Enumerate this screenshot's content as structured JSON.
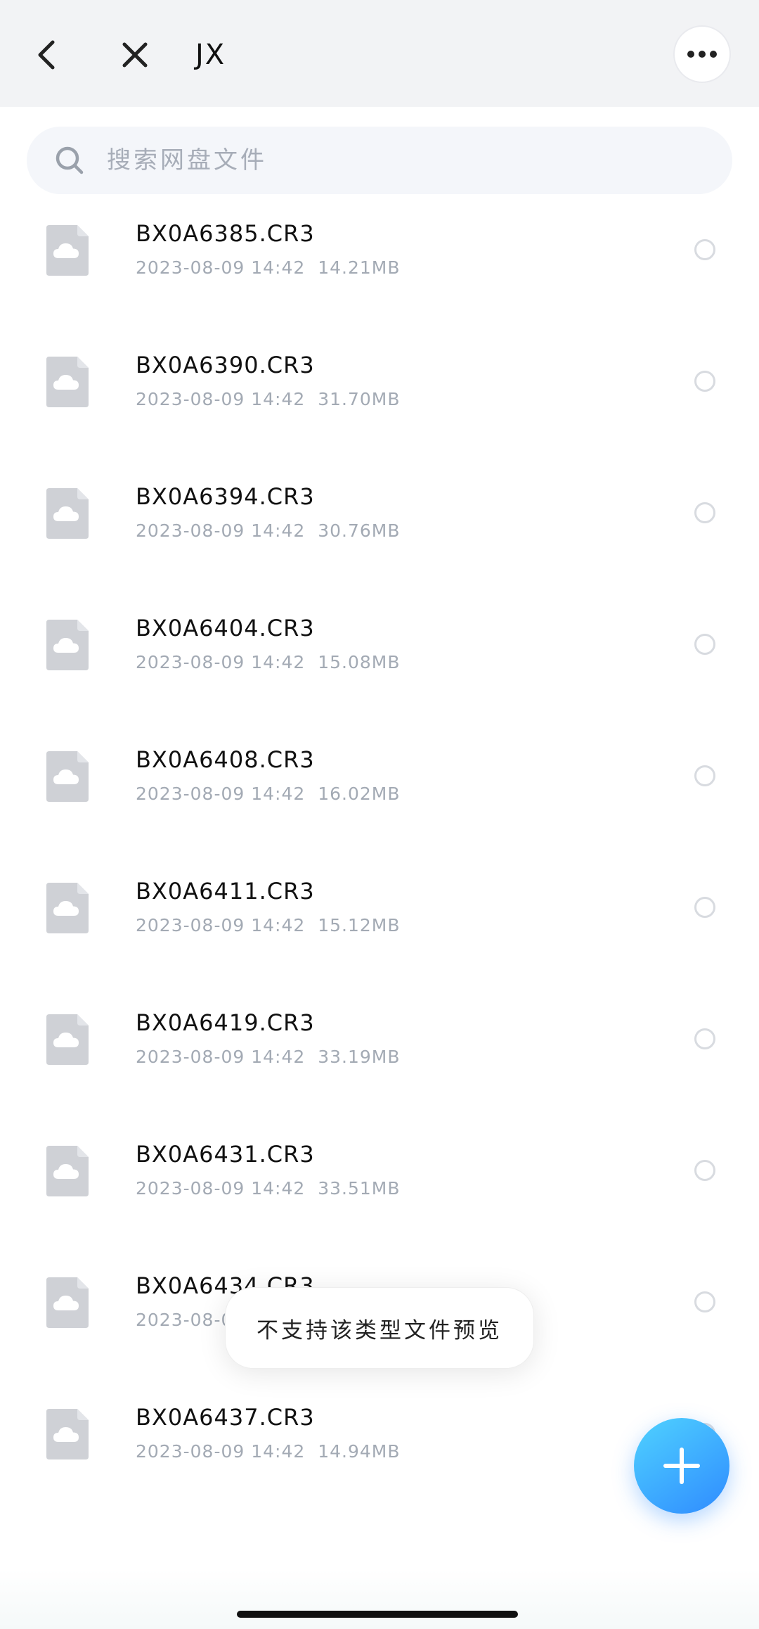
{
  "header": {
    "title": "JX",
    "back_icon": "chevron-left-icon",
    "close_icon": "close-icon",
    "more_icon": "more-horizontal-icon"
  },
  "search": {
    "placeholder": "搜索网盘文件",
    "icon": "search-icon"
  },
  "files": [
    {
      "name": "BX0A6385.CR3",
      "date": "2023-08-09 14:42",
      "size": "14.21MB"
    },
    {
      "name": "BX0A6390.CR3",
      "date": "2023-08-09 14:42",
      "size": "31.70MB"
    },
    {
      "name": "BX0A6394.CR3",
      "date": "2023-08-09 14:42",
      "size": "30.76MB"
    },
    {
      "name": "BX0A6404.CR3",
      "date": "2023-08-09 14:42",
      "size": "15.08MB"
    },
    {
      "name": "BX0A6408.CR3",
      "date": "2023-08-09 14:42",
      "size": "16.02MB"
    },
    {
      "name": "BX0A6411.CR3",
      "date": "2023-08-09 14:42",
      "size": "15.12MB"
    },
    {
      "name": "BX0A6419.CR3",
      "date": "2023-08-09 14:42",
      "size": "33.19MB"
    },
    {
      "name": "BX0A6431.CR3",
      "date": "2023-08-09 14:42",
      "size": "33.51MB"
    },
    {
      "name": "BX0A6434.CR3",
      "date": "2023-08-09 14:42",
      "size": ""
    },
    {
      "name": "BX0A6437.CR3",
      "date": "2023-08-09 14:42",
      "size": "14.94MB"
    }
  ],
  "toast": {
    "message": "不支持该类型文件预览"
  },
  "fab": {
    "icon": "plus-icon"
  },
  "colors": {
    "topbar_bg": "#f2f3f5",
    "meta_text": "#a3aab4",
    "fab_start": "#4fd2ff",
    "fab_end": "#2f8bff"
  }
}
